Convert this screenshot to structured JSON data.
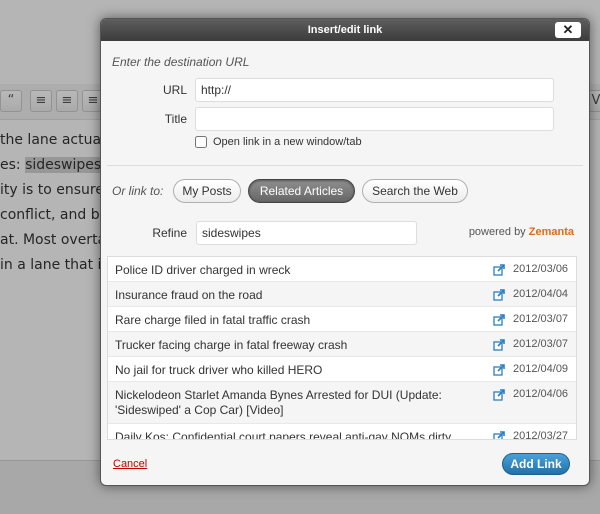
{
  "background": {
    "text_lines": [
      "the lane actuall",
      "es: ",
      "ity is to ensure h",
      "conflict, and bic",
      "at.  Most overtak",
      "in a lane that is"
    ],
    "highlight_word": "sideswipes",
    "highlight_suffix": ",",
    "toolbar_icons": [
      "quote-icon",
      "align-left-icon",
      "align-center-icon",
      "align-right-icon"
    ],
    "toolbar_glyphs": [
      "“",
      "≡",
      "≡",
      "≡"
    ],
    "right_button_label": "V"
  },
  "dialog": {
    "title": "Insert/edit link",
    "close_glyph": "✕",
    "destination_label": "Enter the destination URL",
    "url_label": "URL",
    "url_value": "http://",
    "title_label": "Title",
    "title_value": "",
    "open_new_label": "Open link in a new window/tab",
    "open_new_checked": false,
    "or_link_label": "Or link to:",
    "tabs": [
      {
        "label": "My Posts",
        "active": false
      },
      {
        "label": "Related Articles",
        "active": true
      },
      {
        "label": "Search the Web",
        "active": false
      }
    ],
    "refine_label": "Refine",
    "refine_value": "sideswipes",
    "powered_by_label": "powered by",
    "brand_name": "Zemanta",
    "results": [
      {
        "title": "Police ID driver charged in wreck",
        "date": "2012/03/06"
      },
      {
        "title": "Insurance fraud on the road",
        "date": "2012/04/04"
      },
      {
        "title": "Rare charge filed in fatal traffic crash",
        "date": "2012/03/07"
      },
      {
        "title": "Trucker facing charge in fatal freeway crash",
        "date": "2012/03/07"
      },
      {
        "title": "No jail for truck driver who killed HERO",
        "date": "2012/04/09"
      },
      {
        "title": "Nickelodeon Starlet Amanda Bynes Arrested for DUI (Update: 'Sideswiped' a Cop Car) [Video]",
        "date": "2012/04/06"
      },
      {
        "title": "Daily Kos: Confidential court papers reveal anti-gay NOMs dirty",
        "date": "2012/03/27"
      }
    ],
    "cancel_label": "Cancel",
    "add_link_label": "Add Link"
  },
  "colors": {
    "accent_blue": "#2271a8",
    "brand_orange": "#e06a17",
    "cancel_red": "#c40000",
    "external_icon_blue": "#2a7fc4"
  }
}
